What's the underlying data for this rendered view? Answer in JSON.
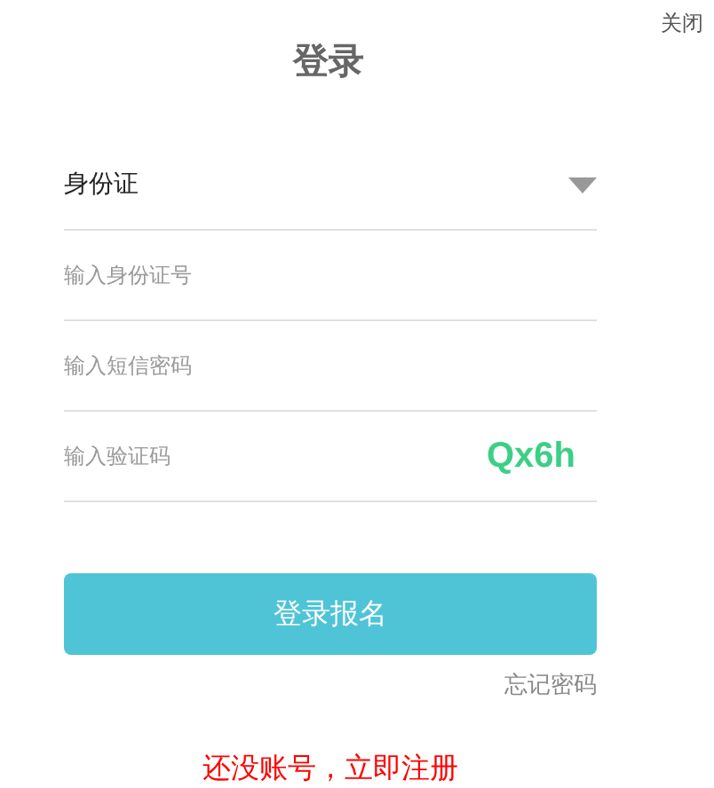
{
  "close": "关闭",
  "title": "登录",
  "id_type": {
    "value": "身份证"
  },
  "fields": [
    {
      "kind": "text",
      "placeholder": "输入身份证号"
    },
    {
      "kind": "text",
      "placeholder": "输入短信密码"
    },
    {
      "kind": "captcha",
      "placeholder": "输入验证码",
      "captcha": "Qx6h"
    }
  ],
  "submit": "登录报名",
  "forgot": "忘记密码",
  "register": "还没账号，立即注册"
}
